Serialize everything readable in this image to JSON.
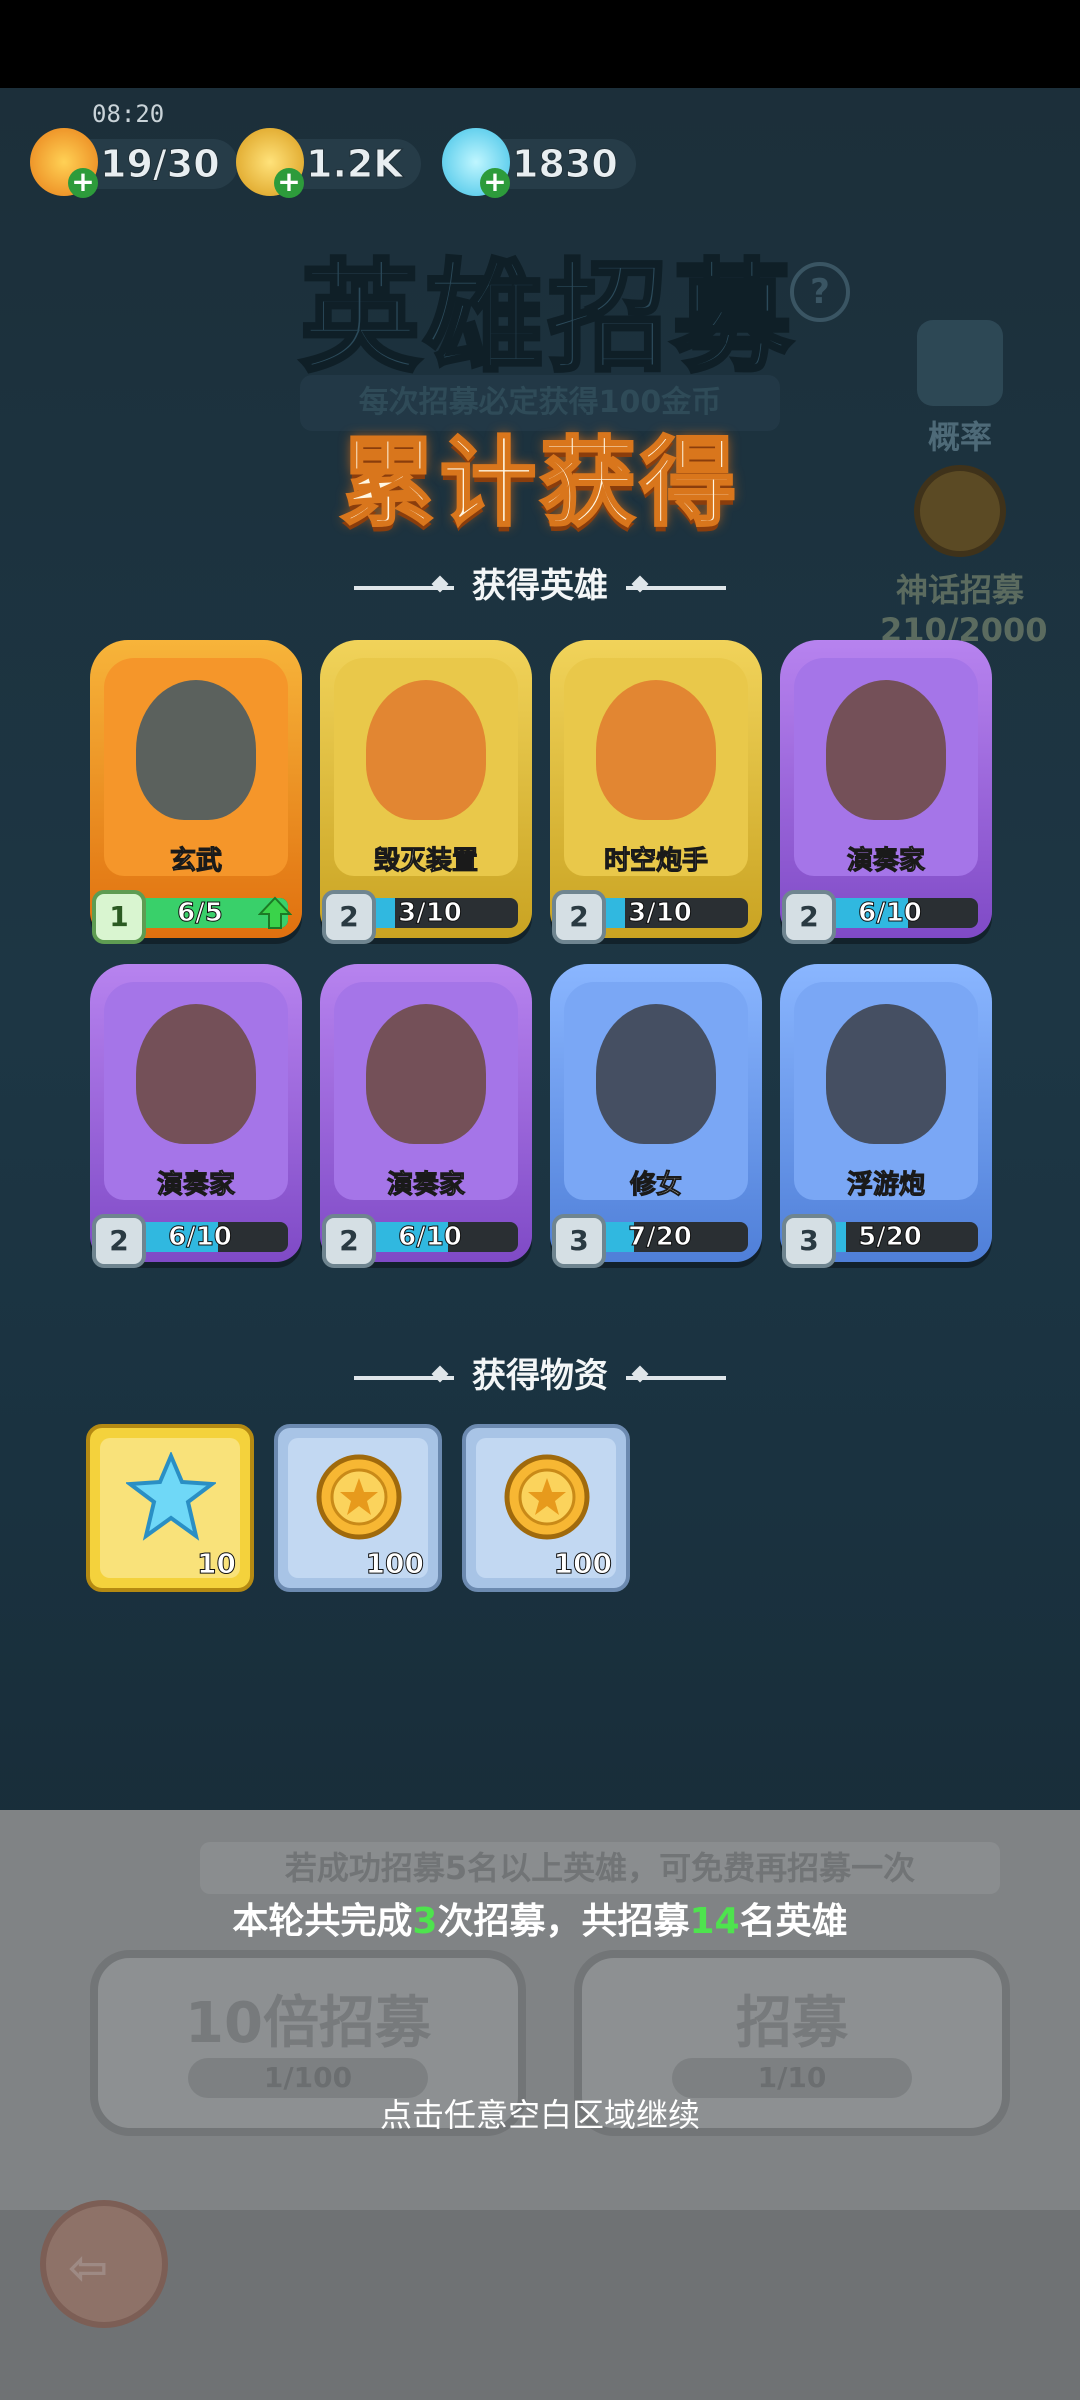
{
  "status": {
    "time": "08:20"
  },
  "resources": [
    {
      "icon": "flame-energy-icon",
      "value": "19/30"
    },
    {
      "icon": "gold-coin-icon",
      "value": "1.2K"
    },
    {
      "icon": "crystal-icon",
      "value": "1830"
    }
  ],
  "background": {
    "title": "英雄招募",
    "banner": "每次招募必定获得100金币",
    "probability_label": "概率",
    "myth_label": "神话招募",
    "myth_progress": "210/2000"
  },
  "popup": {
    "title": "累计获得",
    "heroes_section": "获得英雄",
    "items_section": "获得物资",
    "heroes": [
      {
        "name": "玄武",
        "level": "1",
        "progress": "6/5",
        "ratio": 1.0,
        "rarity": "orange",
        "upgradable": true
      },
      {
        "name": "毁灭装置",
        "level": "2",
        "progress": "3/10",
        "ratio": 0.3,
        "rarity": "gold",
        "upgradable": false
      },
      {
        "name": "时空炮手",
        "level": "2",
        "progress": "3/10",
        "ratio": 0.3,
        "rarity": "gold",
        "upgradable": false
      },
      {
        "name": "演奏家",
        "level": "2",
        "progress": "6/10",
        "ratio": 0.6,
        "rarity": "purple",
        "upgradable": false
      },
      {
        "name": "演奏家",
        "level": "2",
        "progress": "6/10",
        "ratio": 0.6,
        "rarity": "purple",
        "upgradable": false
      },
      {
        "name": "演奏家",
        "level": "2",
        "progress": "6/10",
        "ratio": 0.6,
        "rarity": "purple",
        "upgradable": false
      },
      {
        "name": "修女",
        "level": "3",
        "progress": "7/20",
        "ratio": 0.35,
        "rarity": "blue",
        "upgradable": false
      },
      {
        "name": "浮游炮",
        "level": "3",
        "progress": "5/20",
        "ratio": 0.25,
        "rarity": "blue",
        "upgradable": false
      }
    ],
    "items": [
      {
        "icon": "crystal-icon",
        "qty": "10",
        "frame": "gold"
      },
      {
        "icon": "gold-coin-icon",
        "qty": "100",
        "frame": "blue"
      },
      {
        "icon": "gold-coin-icon",
        "qty": "100",
        "frame": "blue"
      }
    ]
  },
  "bottom": {
    "hint": "若成功招募5名以上英雄，可免费再招募一次",
    "summary_pre": "本轮共完成",
    "summary_times": "3",
    "summary_mid": "次招募，共招募",
    "summary_count": "14",
    "summary_post": "名英雄",
    "btn_ten_label": "10倍招募",
    "btn_ten_cost": "1/100",
    "btn_one_label": "招募",
    "btn_one_cost": "1/10",
    "continue": "点击任意空白区域继续"
  },
  "colors": {
    "orange": "#f39a1e",
    "gold": "#e6c23a",
    "purple": "#a46ae0",
    "blue": "#6a9af0",
    "fill_green": "#39d06a",
    "fill_cyan": "#30b8e0"
  }
}
